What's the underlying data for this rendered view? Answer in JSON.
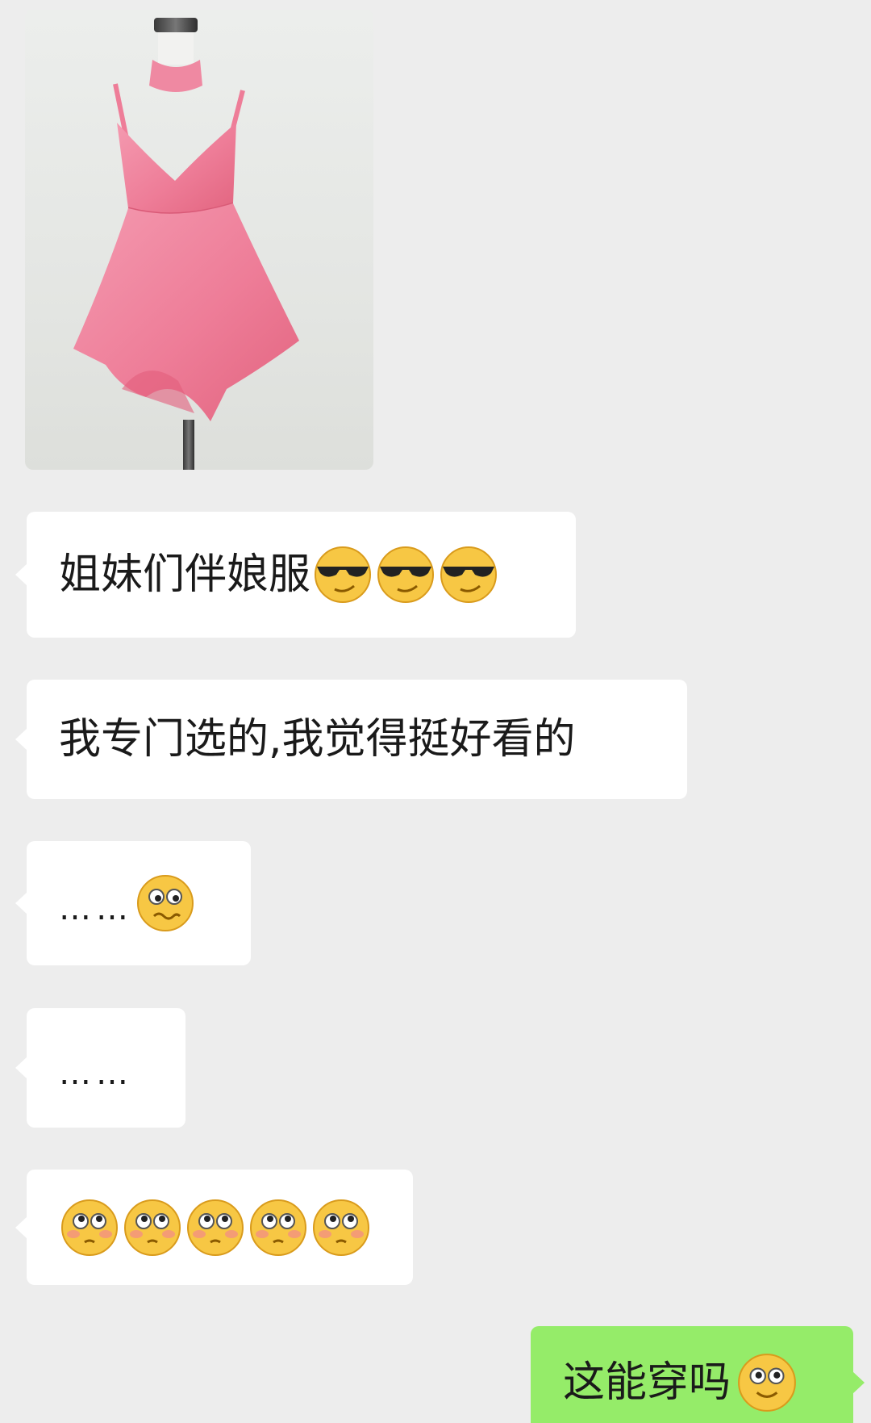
{
  "messages": [
    {
      "type": "image",
      "direction": "incoming",
      "subject": "pink-dress-photo"
    },
    {
      "type": "text",
      "direction": "incoming",
      "text": "姐妹们伴娘服",
      "emojis": [
        "sunglasses-face-icon",
        "sunglasses-face-icon",
        "sunglasses-face-icon"
      ]
    },
    {
      "type": "text",
      "direction": "incoming",
      "text": "我专门选的,我觉得挺好看的"
    },
    {
      "type": "text",
      "direction": "incoming",
      "text": "……",
      "emojis": [
        "awkward-face-icon"
      ]
    },
    {
      "type": "text",
      "direction": "incoming",
      "text": "……"
    },
    {
      "type": "text",
      "direction": "incoming",
      "text": "",
      "emojis": [
        "blushing-face-icon",
        "blushing-face-icon",
        "blushing-face-icon",
        "blushing-face-icon",
        "blushing-face-icon"
      ]
    },
    {
      "type": "text",
      "direction": "outgoing",
      "text": "这能穿吗",
      "emojis": [
        "smile-face-icon"
      ]
    }
  ],
  "colors": {
    "background": "#ededed",
    "incoming_bubble": "#ffffff",
    "outgoing_bubble": "#95ec69",
    "dress": "#f07a98"
  }
}
